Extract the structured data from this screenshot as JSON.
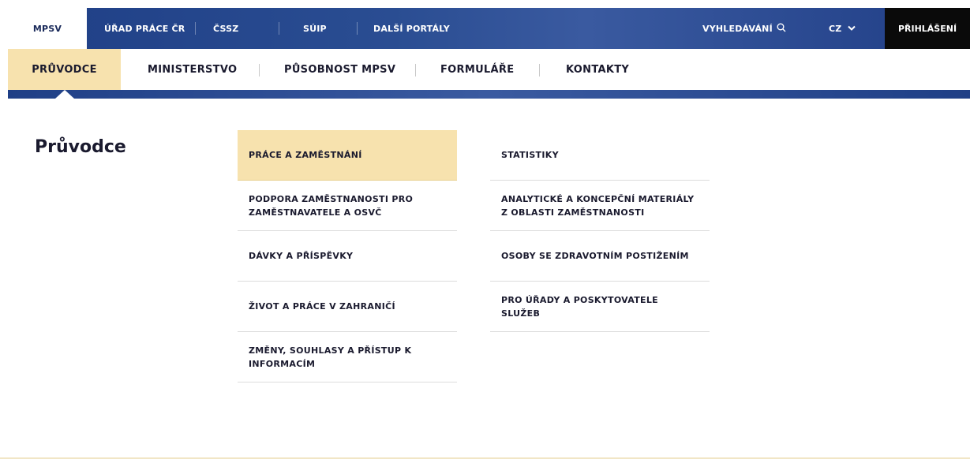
{
  "topbar": {
    "portals": [
      {
        "label": "MPSV",
        "active": true
      },
      {
        "label": "ÚŘAD PRÁCE ČR",
        "active": false
      },
      {
        "label": "ČSSZ",
        "active": false
      },
      {
        "label": "SÚIP",
        "active": false
      },
      {
        "label": "DALŠÍ PORTÁLY",
        "active": false
      }
    ],
    "search_label": "VYHLEDÁVÁNÍ",
    "search_icon": "search-icon",
    "language_label": "CZ",
    "language_icon": "chevron-down-icon",
    "login_label": "PŘIHLÁŠENÍ"
  },
  "mainnav": {
    "items": [
      {
        "label": "PRŮVODCE",
        "active": true
      },
      {
        "label": "MINISTERSTVO",
        "active": false
      },
      {
        "label": "PŮSOBNOST MPSV",
        "active": false
      },
      {
        "label": "FORMULÁŘE",
        "active": false
      },
      {
        "label": "KONTAKTY",
        "active": false
      }
    ]
  },
  "main": {
    "title": "Průvodce",
    "left_links": [
      {
        "label": "PRÁCE A ZAMĚSTNÁNÍ",
        "active": true
      },
      {
        "label": "PODPORA ZAMĚSTNANOSTI PRO ZAMĚSTNAVATELE A OSVČ",
        "active": false
      },
      {
        "label": "DÁVKY A PŘÍSPĚVKY",
        "active": false
      },
      {
        "label": "ŽIVOT A PRÁCE V ZAHRANIČÍ",
        "active": false
      },
      {
        "label": "ZMĚNY, SOUHLASY A PŘÍSTUP K INFORMACÍM",
        "active": false
      }
    ],
    "right_links": [
      {
        "label": "STATISTIKY",
        "active": false
      },
      {
        "label": "ANALYTICKÉ A KONCEPČNÍ MATERIÁLY Z OBLASTI ZAMĚSTNANOSTI",
        "active": false
      },
      {
        "label": "OSOBY SE ZDRAVOTNÍM POSTIŽENÍM",
        "active": false
      },
      {
        "label": "PRO ÚŘADY A POSKYTOVATELE SLUŽEB",
        "active": false
      }
    ]
  },
  "colors": {
    "brand_blue": "#1f3f86",
    "highlight": "#f7e2ae",
    "login_bg": "#0a0a0a"
  }
}
